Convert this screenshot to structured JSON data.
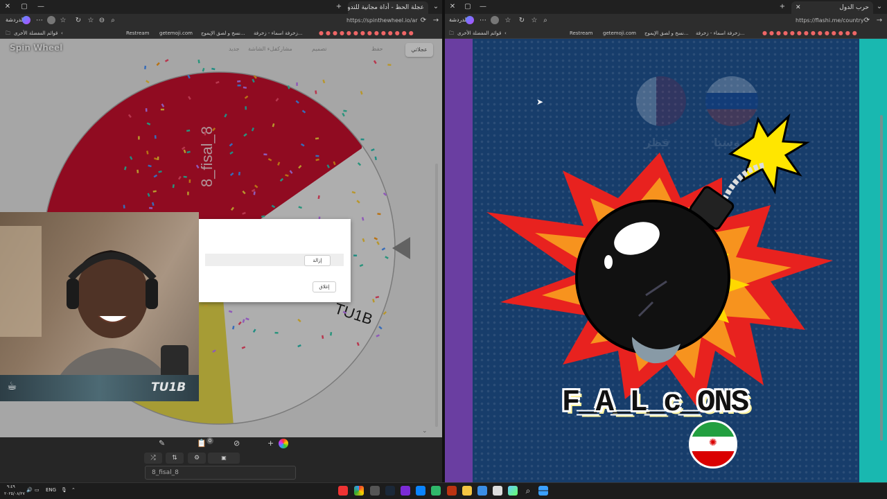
{
  "left_browser": {
    "tab_title": "عجلة الحظ - أداة مجانية للتدوير",
    "profile_label": "الدردشة",
    "url": "https://spinthewheel.io/ar",
    "bookmarks_folder": "قوائم المفضلة الأخرى",
    "bookmarks": [
      "Restream",
      "getemoji.com",
      "نسخ و لصق الإيموج...",
      "زخرفة اسماء - زخرفة..."
    ]
  },
  "right_browser": {
    "tab_title": "حرب الدول",
    "profile_label": "الدردشة",
    "url": "https://flashi.me/country",
    "bookmarks_folder": "قوائم المفضلة الأخرى",
    "bookmarks": [
      "Restream",
      "getemoji.com",
      "نسخ و لصق الإيموج...",
      "زخرفة اسماء - زخرفة..."
    ]
  },
  "spin_wheel": {
    "logo": "Spin Wheel",
    "top_menu": [
      "عجلاتي",
      "حفظ",
      "مشاركة",
      "تصميم",
      "ملء الشاشة",
      "جديد"
    ],
    "segments": [
      {
        "label": "8_fisal_8",
        "color": "#c8102e"
      },
      {
        "label": "TU1B",
        "color": "#f2f2f2"
      },
      {
        "label": "",
        "color": "#e6d84a"
      }
    ],
    "modal": {
      "primary_button": "إزالة",
      "close_button": "إغلاق"
    },
    "bottom_tools": [
      "edit-icon",
      "list-icon",
      "hide-icon",
      "add-icon"
    ],
    "badge_count": "0",
    "entry_value": "8_fisal_8"
  },
  "webcam": {
    "overlay_text": "TU1B"
  },
  "flashi": {
    "team_name": "F_A_L_c_ONS",
    "faded_labels": [
      "قطر",
      "روسيا"
    ],
    "flag": "iran-flag",
    "colors": {
      "background": "#173d6b",
      "left_stripe": "#6a3ea1",
      "right_stripe": "#19b8b0"
    }
  },
  "taskbar": {
    "language": "ENG",
    "time": "٩:٤٩",
    "date": "٢٠٢٥/٠٨/٢٧"
  }
}
